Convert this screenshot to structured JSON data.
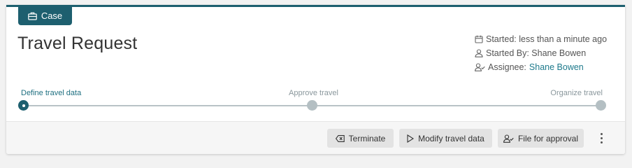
{
  "case_tab": {
    "label": "Case",
    "icon": "briefcase-icon"
  },
  "title": "Travel Request",
  "meta": {
    "started": {
      "icon": "calendar-icon",
      "text": "Started: less than a minute ago"
    },
    "started_by": {
      "icon": "user-icon",
      "text": "Started By: Shane Bowen"
    },
    "assignee": {
      "icon": "user-check-icon",
      "label": "Assignee:",
      "name": "Shane Bowen"
    }
  },
  "stages": [
    {
      "label": "Define travel data",
      "state": "active"
    },
    {
      "label": "Approve travel",
      "state": "pending"
    },
    {
      "label": "Organize travel",
      "state": "pending"
    }
  ],
  "actions": {
    "terminate": {
      "label": "Terminate",
      "icon": "backspace-icon"
    },
    "modify": {
      "label": "Modify travel data",
      "icon": "play-icon"
    },
    "file_approval": {
      "label": "File for approval",
      "icon": "user-check-icon"
    },
    "more": {
      "icon": "more-vertical-icon"
    }
  },
  "colors": {
    "accent": "#1d5f6f",
    "link": "#1e7a8c",
    "button_bg": "#e3e3e3",
    "pending_dot": "#b4bfc3"
  }
}
